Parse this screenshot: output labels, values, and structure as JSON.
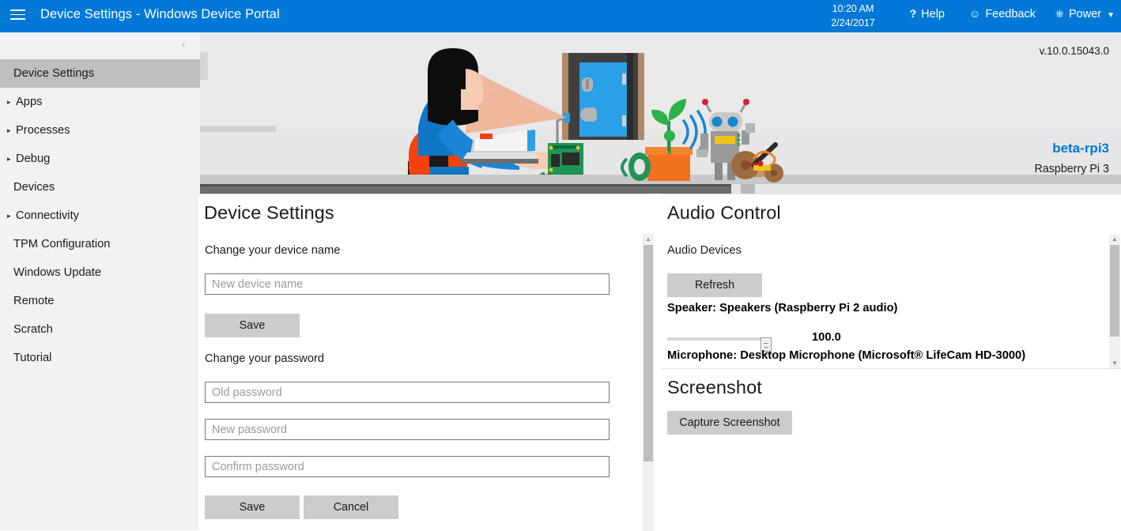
{
  "header": {
    "menu_icon": "hamburger-icon",
    "title": "Device Settings - Windows Device Portal",
    "time": "10:20 AM",
    "date": "2/24/2017",
    "help_icon": "question-mark-icon",
    "help_label": "Help",
    "feedback_icon": "smiley-face-icon",
    "feedback_label": "Feedback",
    "power_icon": "power-icon",
    "power_label": "Power",
    "power_caret": "▼",
    "accent_color": "#0078d7"
  },
  "sidebar": {
    "collapse_icon": "chevron-left-icon",
    "collapse_glyph": "‹",
    "selected_bg": "#bfbfbf",
    "items": [
      {
        "label": "Device Settings",
        "caret": "",
        "selected": true
      },
      {
        "label": "Apps",
        "caret": "▸",
        "selected": false
      },
      {
        "label": "Processes",
        "caret": "▸",
        "selected": false
      },
      {
        "label": "Debug",
        "caret": "▸",
        "selected": false
      },
      {
        "label": "Devices",
        "caret": "",
        "selected": false
      },
      {
        "label": "Connectivity",
        "caret": "▸",
        "selected": false
      },
      {
        "label": "TPM Configuration",
        "caret": "",
        "selected": false
      },
      {
        "label": "Windows Update",
        "caret": "",
        "selected": false
      },
      {
        "label": "Remote",
        "caret": "",
        "selected": false
      },
      {
        "label": "Scratch",
        "caret": "",
        "selected": false
      },
      {
        "label": "Tutorial",
        "caret": "",
        "selected": false
      }
    ]
  },
  "banner": {
    "version": "v.10.0.15043.0",
    "device_name": "beta-rpi3",
    "device_model": "Raspberry Pi 3",
    "device_name_color": "#0078d7",
    "illustration": "developer-at-desk-with-iot-devices-illustration"
  },
  "device_settings": {
    "title": "Device Settings",
    "device_name_label": "Change your device name",
    "device_name_placeholder": "New device name",
    "device_name_value": "",
    "save_name_label": "Save",
    "password_label": "Change your password",
    "old_password_placeholder": "Old password",
    "old_password_value": "",
    "new_password_placeholder": "New password",
    "new_password_value": "",
    "confirm_password_placeholder": "Confirm password",
    "confirm_password_value": "",
    "save_password_label": "Save",
    "cancel_password_label": "Cancel",
    "scroll_up_glyph": "▲"
  },
  "audio_control": {
    "title": "Audio Control",
    "devices_label": "Audio Devices",
    "refresh_label": "Refresh",
    "speaker_label": "Speaker: Speakers (Raspberry Pi 2 audio)",
    "volume_value": "100.0",
    "volume_percent": 100,
    "microphone_label": "Microphone: Desktop Microphone (Microsoft® LifeCam HD-3000)",
    "scroll_up_glyph": "▲",
    "scroll_down_glyph": "▼"
  },
  "screenshot": {
    "title": "Screenshot",
    "capture_label": "Capture Screenshot"
  }
}
